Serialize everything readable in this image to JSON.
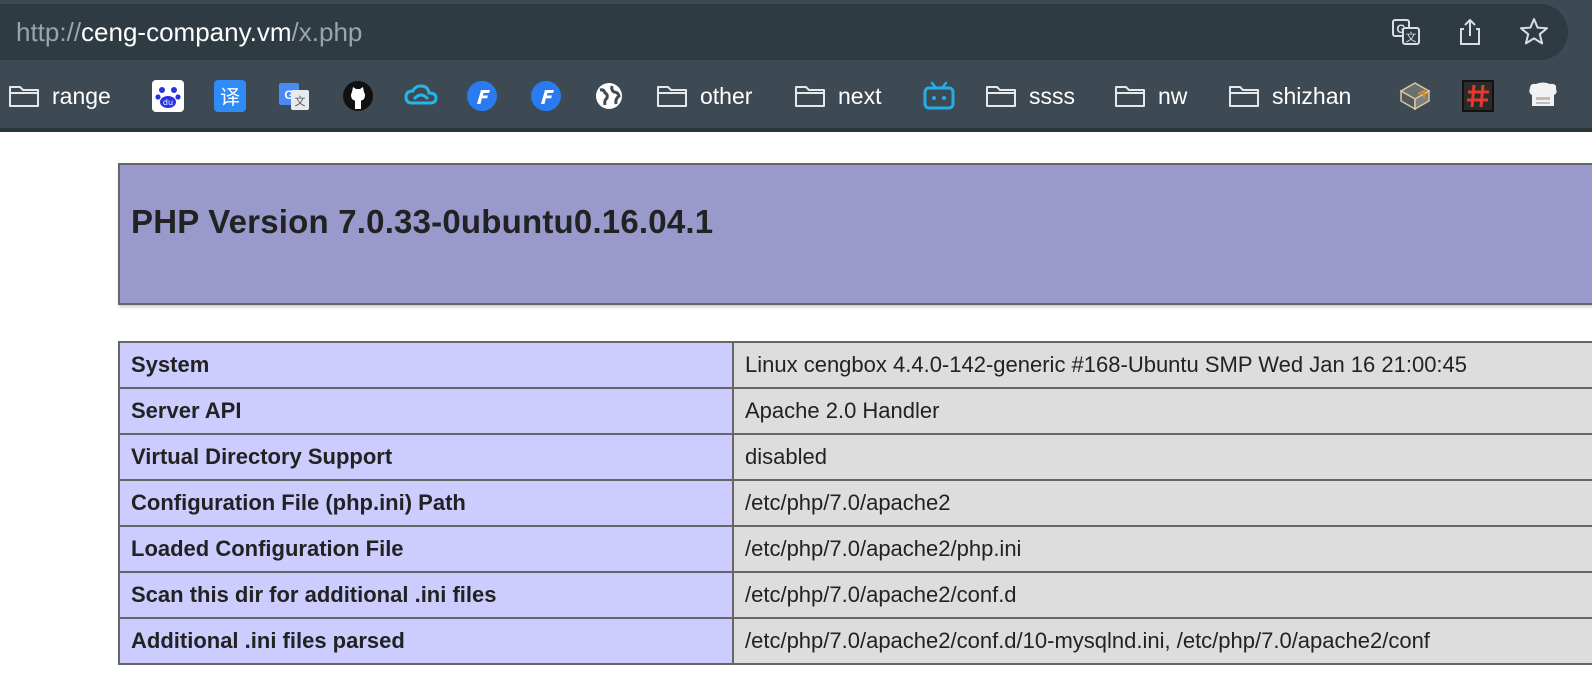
{
  "browser": {
    "url_scheme": "http://",
    "url_host": "ceng-company.vm",
    "url_path": "/x.php",
    "actions": [
      "translate-icon",
      "share-icon",
      "bookmark-star-icon"
    ],
    "bookmarks": [
      {
        "type": "folder",
        "label": "range"
      },
      {
        "type": "icon",
        "icon": "baidu-icon"
      },
      {
        "type": "icon",
        "icon": "translate-yi-icon"
      },
      {
        "type": "icon",
        "icon": "google-translate-icon"
      },
      {
        "type": "icon",
        "icon": "github-icon"
      },
      {
        "type": "icon",
        "icon": "cloud-icon"
      },
      {
        "type": "icon",
        "icon": "f-logo-icon"
      },
      {
        "type": "icon",
        "icon": "f-logo-icon"
      },
      {
        "type": "icon",
        "icon": "globe-icon"
      },
      {
        "type": "folder",
        "label": "other"
      },
      {
        "type": "folder",
        "label": "next"
      },
      {
        "type": "icon",
        "icon": "bilibili-icon"
      },
      {
        "type": "folder",
        "label": "ssss"
      },
      {
        "type": "folder",
        "label": "nw"
      },
      {
        "type": "folder",
        "label": "shizhan"
      },
      {
        "type": "icon",
        "icon": "cube-icon"
      },
      {
        "type": "icon",
        "icon": "hash-icon"
      },
      {
        "type": "icon",
        "icon": "server-icon"
      }
    ]
  },
  "php": {
    "title": "PHP Version 7.0.33-0ubuntu0.16.04.1",
    "rows": [
      {
        "key": "System",
        "value": "Linux cengbox 4.4.0-142-generic #168-Ubuntu SMP Wed Jan 16 21:00:45"
      },
      {
        "key": "Server API",
        "value": "Apache 2.0 Handler"
      },
      {
        "key": "Virtual Directory Support",
        "value": "disabled"
      },
      {
        "key": "Configuration File (php.ini) Path",
        "value": "/etc/php/7.0/apache2"
      },
      {
        "key": "Loaded Configuration File",
        "value": "/etc/php/7.0/apache2/php.ini"
      },
      {
        "key": "Scan this dir for additional .ini files",
        "value": "/etc/php/7.0/apache2/conf.d"
      },
      {
        "key": "Additional .ini files parsed",
        "value": "/etc/php/7.0/apache2/conf.d/10-mysqlnd.ini, /etc/php/7.0/apache2/conf"
      }
    ]
  },
  "colors": {
    "header_bg": "#9999cc",
    "key_bg": "#ccccff",
    "value_bg": "#dddddd",
    "chrome_bg": "#3d4a53"
  }
}
